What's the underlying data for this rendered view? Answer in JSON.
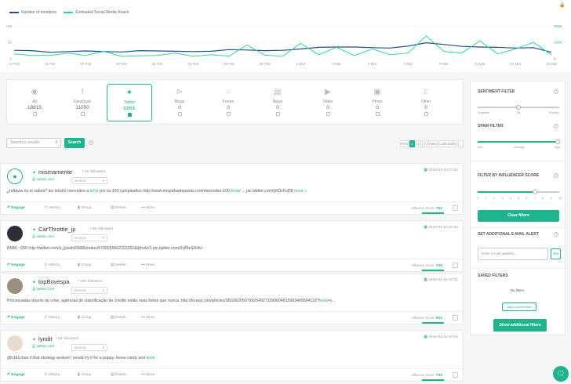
{
  "chart": {
    "legend": [
      "Number of mentions",
      "Estimated Social Media Reach"
    ],
    "left_ticks": [
      "100",
      "50",
      "0"
    ],
    "right_ticks": [
      "200K",
      "100K",
      "0"
    ],
    "x_labels": [
      "14 Feb",
      "16 Feb",
      "18 Feb",
      "20 Feb",
      "22 Feb",
      "24 Feb",
      "26 Feb",
      "28 Feb",
      "1 Mar",
      "3 Mar",
      "5 Mar",
      "7 Mar",
      "9 Mar",
      "11 Mar",
      "13 Mar",
      "15 Mar"
    ],
    "colors": {
      "mentions": "#1f4e8c",
      "reach": "#2ed5a5"
    },
    "pin_icon": "lock-icon"
  },
  "chart_data": {
    "type": "line",
    "x": [
      "14 Feb",
      "15 Feb",
      "16 Feb",
      "17 Feb",
      "18 Feb",
      "19 Feb",
      "20 Feb",
      "21 Feb",
      "22 Feb",
      "23 Feb",
      "24 Feb",
      "25 Feb",
      "26 Feb",
      "27 Feb",
      "28 Feb",
      "29 Feb",
      "1 Mar",
      "2 Mar",
      "3 Mar",
      "4 Mar",
      "5 Mar",
      "6 Mar",
      "7 Mar",
      "8 Mar",
      "9 Mar",
      "10 Mar",
      "11 Mar",
      "12 Mar",
      "13 Mar",
      "14 Mar",
      "15 Mar"
    ],
    "series": [
      {
        "name": "Number of mentions",
        "axis": "left",
        "values": [
          26,
          25,
          20,
          22,
          24,
          22,
          21,
          25,
          24,
          23,
          22,
          23,
          28,
          27,
          25,
          26,
          30,
          35,
          36,
          36,
          34,
          33,
          39,
          49,
          44,
          38,
          36,
          35,
          33,
          34,
          20
        ]
      },
      {
        "name": "Estimated Social Media Reach",
        "axis": "right",
        "values": [
          30000,
          20000,
          20000,
          35000,
          20000,
          45000,
          15000,
          18000,
          20000,
          35000,
          15000,
          25000,
          15000,
          85000,
          22000,
          15000,
          95000,
          25000,
          70000,
          20000,
          60000,
          25000,
          35000,
          140000,
          45000,
          35000,
          110000,
          30000,
          60000,
          100000,
          25000
        ]
      }
    ],
    "ylim_left": [
      0,
      120
    ],
    "ylim_right": [
      0,
      240000
    ]
  },
  "categories": [
    {
      "name": "All",
      "count": "18815",
      "icon": "globe-icon",
      "active": false
    },
    {
      "name": "Facebook",
      "count": "11050",
      "icon": "facebook-icon",
      "active": false
    },
    {
      "name": "Twitter",
      "count": "6965",
      "icon": "twitter-icon",
      "active": true
    },
    {
      "name": "Blogs",
      "count": "0",
      "icon": "rss-icon",
      "active": false
    },
    {
      "name": "Forum",
      "count": "0",
      "icon": "chat-icon",
      "active": false
    },
    {
      "name": "News",
      "count": "0",
      "icon": "newspaper-icon",
      "active": false
    },
    {
      "name": "Video",
      "count": "0",
      "icon": "video-icon",
      "active": false
    },
    {
      "name": "Photo",
      "count": "0",
      "icon": "photo-icon",
      "active": false
    },
    {
      "name": "Other",
      "count": "0",
      "icon": "share-icon",
      "active": false
    }
  ],
  "search": {
    "placeholder": "Search in results",
    "button": "Search",
    "help": "?"
  },
  "pagination": {
    "first": "First",
    "pages": [
      "1",
      "2",
      "3"
    ],
    "next": "Next",
    "last": "Last (226)"
  },
  "actions": {
    "engage": "Engage",
    "history": "History",
    "group": "Group",
    "delete": "Delete",
    "more": "More",
    "influence_label": "Influence Score:"
  },
  "posts": [
    {
      "user": "mismamente",
      "followers": "3K followers",
      "source": "twitter.com",
      "sentiment": "Neutral",
      "date": "2016-03-15 07:02",
      "text_before": "¿todavía no lo sabes? así felicitó mercedes a ",
      "hl1": "bmw",
      "text_mid": " por su 100 cumpleaños http://www.mispafasdepasta.com/mercedes-100-",
      "hl2": "bmw",
      "text_after": "/ ... pic.twitter.com/ljXOcFuD8",
      "more": "more »",
      "score": "7/10"
    },
    {
      "user": "CarThrottle_jp",
      "followers": "6K followers",
      "source": "twitter.com",
      "sentiment": "Neutral",
      "date": "2016-03-15 07:02",
      "text_before": "BMW - 650 http://twitter.com/a_jooah03686/status/5709055602722201&/photo/1 pic.twitter.com/3y89e/j2Hhc",
      "hl1": "",
      "text_mid": "",
      "hl2": "",
      "text_after": "",
      "more": "",
      "score": "7/10"
    },
    {
      "user": "topBovespa",
      "followers": "10K followers",
      "source": "twitter.com",
      "sentiment": "Neutral",
      "date": "2016-03-15 07:01",
      "text_before": "Processadas depois da crise, agências de classificação de crédito estão mais fortes que nunca. http://br.wsj.com/articles/SB10620507992549273295604815993409594122?",
      "hl1": "tesla",
      "text_mid": "=y...",
      "hl2": "",
      "text_after": "",
      "more": "",
      "score": "8/10"
    },
    {
      "user": "lyndit",
      "followers": "5K followers",
      "source": "twitter.com",
      "sentiment": "Neutral",
      "date": "2016-03-15 07:01",
      "text_before": "@k1k1chan if that strategy worked I would try it for a puppy, horse ranch and ",
      "hl1": "tesla",
      "text_mid": "",
      "hl2": "",
      "text_after": "",
      "more": "",
      "score": "7/10"
    }
  ],
  "sidebar": {
    "sentiment_title": "SENTIMENT FILTER",
    "sentiment_labels": [
      "Negative",
      "All",
      "Positive"
    ],
    "spam_title": "SPAM FILTER",
    "spam_labels": [
      "low",
      "average",
      "high"
    ],
    "influencer_title": "FILTER BY INFLUENCER SCORE",
    "influencer_ticks": [
      "0",
      "1",
      "2",
      "3",
      "4",
      "5",
      "6",
      "7",
      "8",
      "9",
      "10"
    ],
    "influencer_value": 7,
    "clear": "Clear filters",
    "email_title": "SET ADDITIONAL E-MAIL ALERT",
    "email_placeholder": "Enter e-mail address...",
    "email_button": "Set",
    "saved_title": "SAVED FILTERS",
    "no_filters": "No filters.",
    "save_current": "Save current filter",
    "show_additional": "Show additional filters"
  }
}
